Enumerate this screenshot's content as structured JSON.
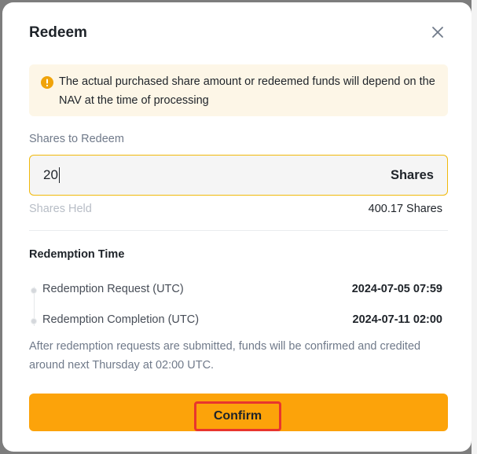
{
  "modal": {
    "title": "Redeem",
    "close_icon": "close-icon"
  },
  "notice": {
    "icon": "warning-icon",
    "text": "The actual purchased share amount or redeemed funds will depend on the NAV at the time of processing",
    "icon_color": "#f0a30a",
    "background": "#fdf6e7"
  },
  "shares_input": {
    "label": "Shares to Redeem",
    "value": "20",
    "unit": "Shares",
    "border_color": "#f0b90b"
  },
  "shares_held": {
    "label": "Shares Held",
    "value": "400.17 Shares"
  },
  "redemption_time": {
    "title": "Redemption Time",
    "rows": [
      {
        "label": "Redemption Request (UTC)",
        "value": "2024-07-05 07:59"
      },
      {
        "label": "Redemption Completion (UTC)",
        "value": "2024-07-11 02:00"
      }
    ],
    "note": "After redemption requests are submitted, funds will be confirmed and credited around next Thursday at 02:00 UTC."
  },
  "confirm_button": {
    "label": "Confirm",
    "color": "#fca30a",
    "highlight_color": "#e8352e"
  }
}
